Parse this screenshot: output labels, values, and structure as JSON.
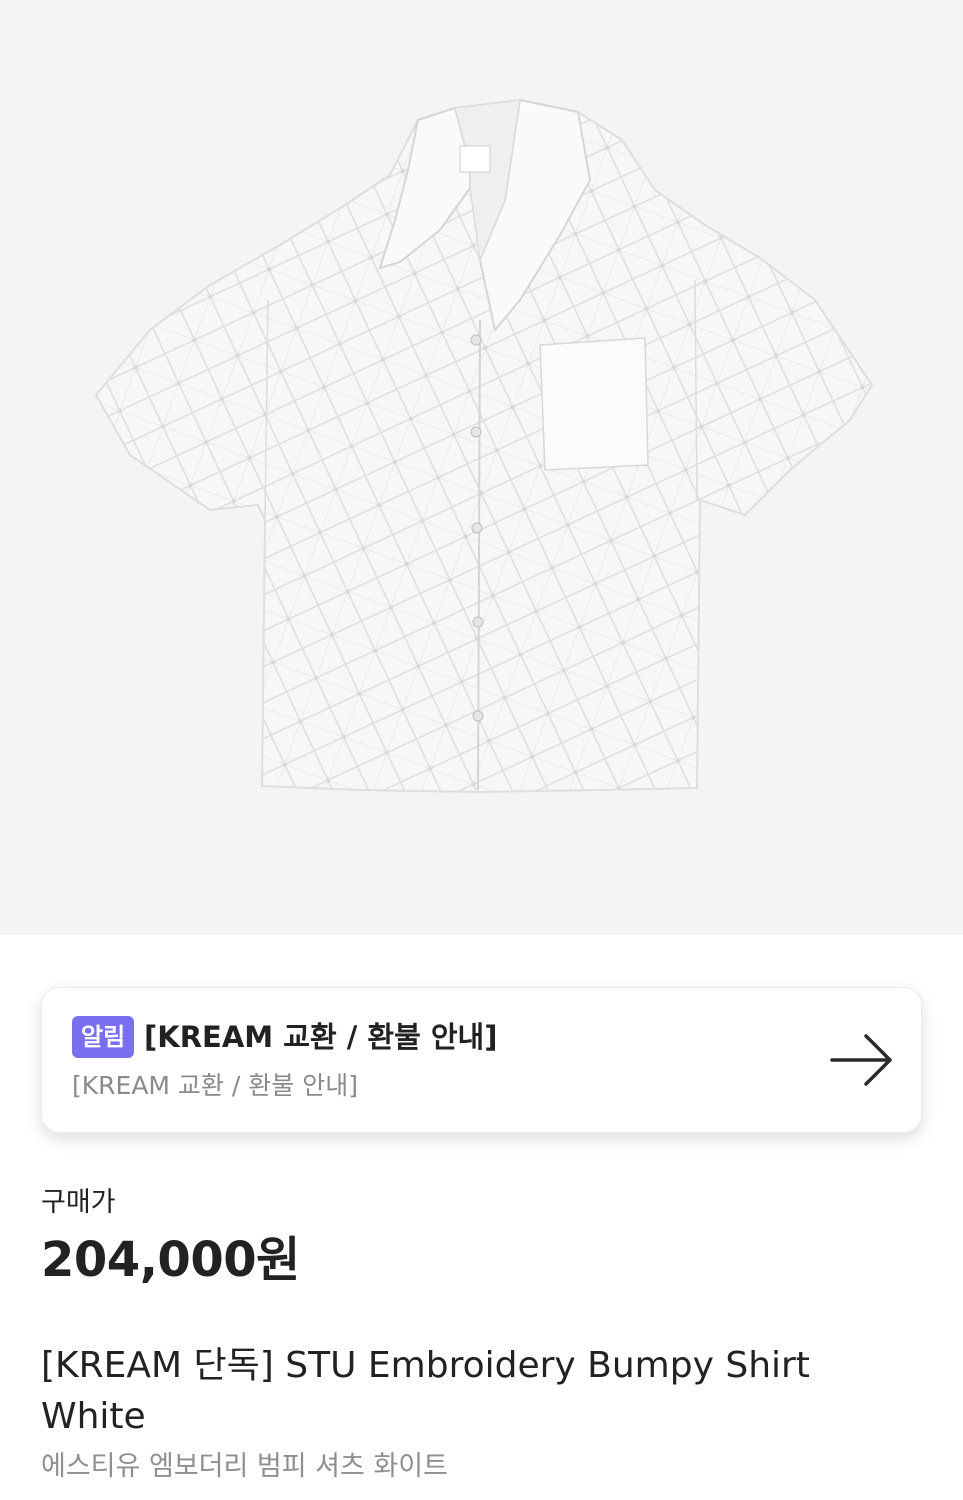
{
  "notice": {
    "badge": "알림",
    "title": "[KREAM 교환 / 환불 안내]",
    "subtitle": "[KREAM 교환 / 환불 안내]",
    "arrow_icon": "arrow-right-icon"
  },
  "price": {
    "label": "구매가",
    "value": "204,000원"
  },
  "product": {
    "name": "[KREAM 단독] STU Embroidery Bumpy Shirt White",
    "name_ko": "에스티유 엠보더리 범피 셔츠 화이트",
    "image_icon": "product-shirt-image"
  },
  "colors": {
    "badge": "#7b6ff0",
    "hero_bg": "#f4f4f4",
    "text": "#222222",
    "muted": "#8a8a8a"
  }
}
